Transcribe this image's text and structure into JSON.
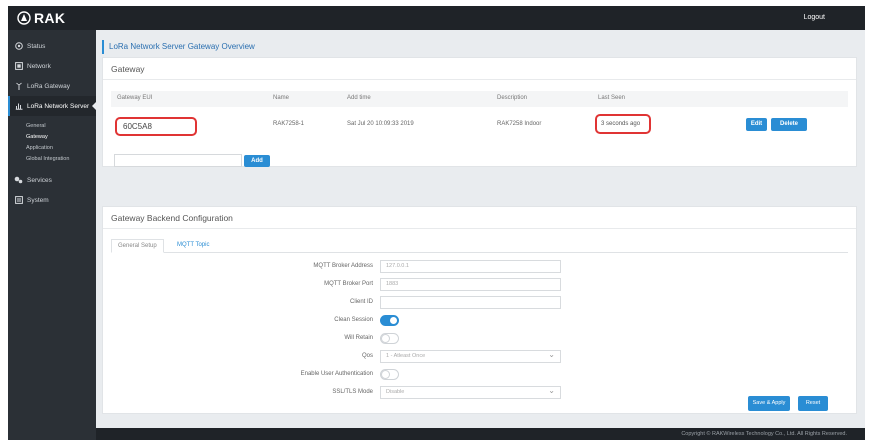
{
  "header": {
    "brand": "RAK",
    "logout": "Logout"
  },
  "sidebar": {
    "items": [
      {
        "label": "Status",
        "icon": "status-icon"
      },
      {
        "label": "Network",
        "icon": "network-icon"
      },
      {
        "label": "LoRa Gateway",
        "icon": "antenna-icon"
      },
      {
        "label": "LoRa Network Server",
        "icon": "chart-icon"
      }
    ],
    "sub_items": [
      "General",
      "Gateway",
      "Application",
      "Global Integration"
    ],
    "items_bottom": [
      {
        "label": "Services",
        "icon": "services-icon"
      },
      {
        "label": "System",
        "icon": "system-icon"
      }
    ]
  },
  "page": {
    "title": "LoRa Network Server Gateway Overview"
  },
  "gateway_panel": {
    "title": "Gateway",
    "columns": [
      "Gateway EUI",
      "Name",
      "Add time",
      "Description",
      "Last Seen"
    ],
    "rows": [
      {
        "eui": "60C5A8",
        "name": "RAK7258-1",
        "add_time": "Sat Jul 20 10:09:33 2019",
        "description": "RAK7258 Indoor",
        "last_seen": "3 seconds ago"
      }
    ],
    "edit_label": "Edit",
    "delete_label": "Delete",
    "add_input_value": "",
    "add_label": "Add"
  },
  "backend_panel": {
    "title": "Gateway Backend Configuration",
    "tabs": [
      "General Setup",
      "MQTT Topic"
    ],
    "fields": {
      "broker_address": {
        "label": "MQTT Broker Address",
        "value": "127.0.0.1"
      },
      "broker_port": {
        "label": "MQTT Broker Port",
        "value": "1883"
      },
      "client_id": {
        "label": "Client ID",
        "value": ""
      },
      "clean_session": {
        "label": "Clean Session",
        "state": "on"
      },
      "will_retain": {
        "label": "Will Retain",
        "state": "off"
      },
      "qos": {
        "label": "Qos",
        "value": "1 - Atleast Once"
      },
      "user_auth": {
        "label": "Enable User Authentication",
        "state": "off"
      },
      "ssl_tls": {
        "label": "SSL/TLS Mode",
        "value": "Disable"
      }
    },
    "save_label": "Save & Apply",
    "reset_label": "Reset"
  },
  "footer": {
    "copyright": "Copyright © RAKWireless Technology Co., Ltd. All Rights Reserved."
  },
  "colors": {
    "accent": "#2a8dd4",
    "sidebar": "#2b3036",
    "topbar": "#1f2328",
    "highlight": "#e03434"
  }
}
